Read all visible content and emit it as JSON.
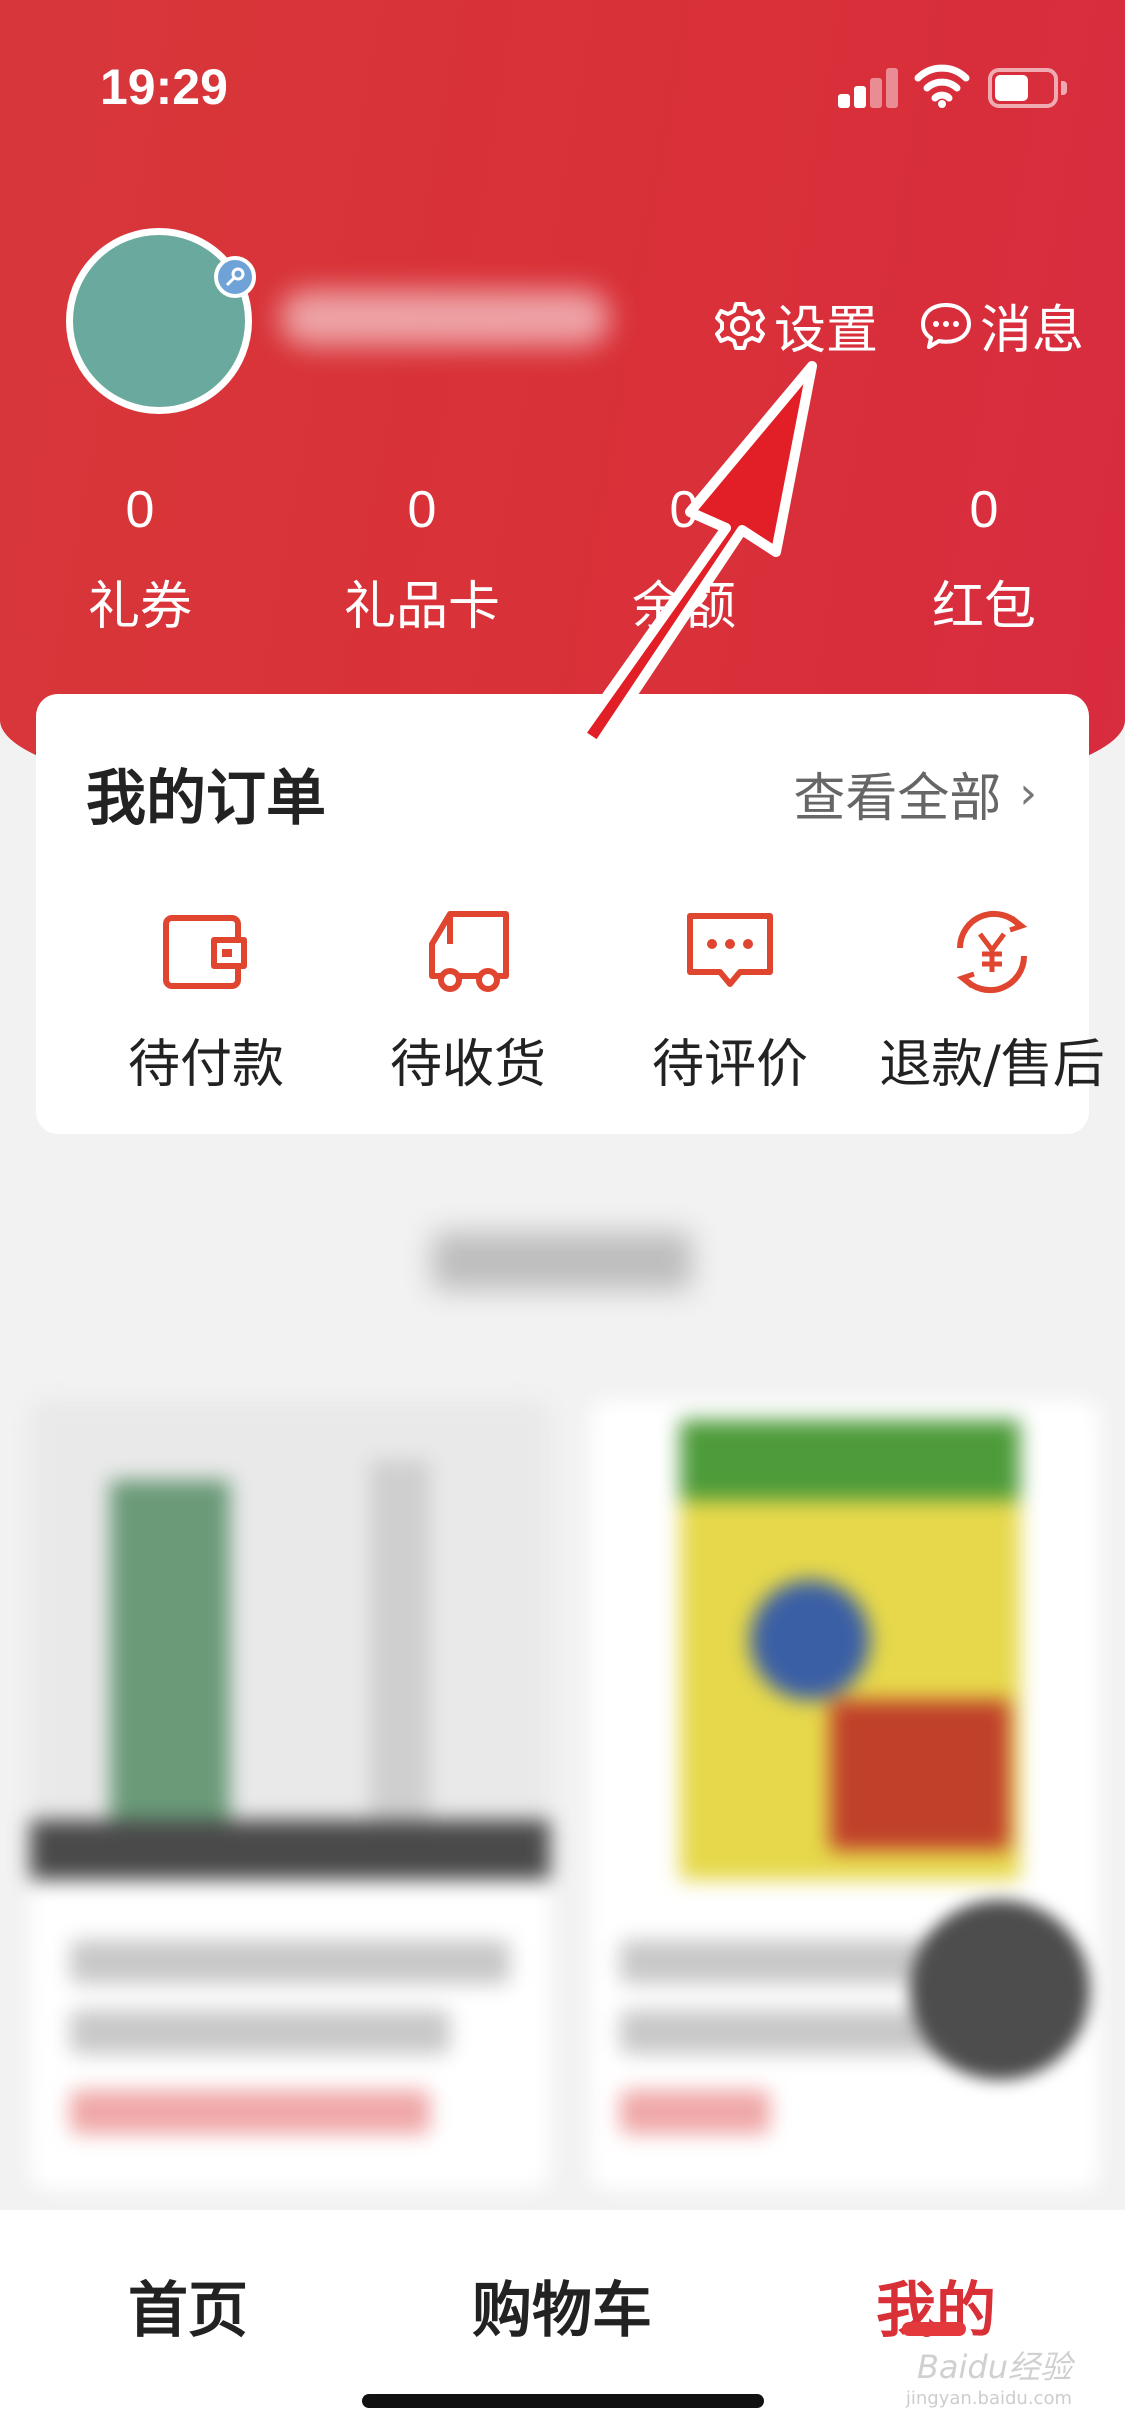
{
  "status_bar": {
    "time": "19:29",
    "battery_level": 0.5,
    "icons": [
      "cellular-signal-icon",
      "wifi-icon",
      "battery-icon"
    ]
  },
  "header": {
    "settings_label": "设置",
    "messages_label": "消息",
    "settings_icon": "gear-icon",
    "messages_icon": "chat-bubble-icon"
  },
  "stats": [
    {
      "value": "0",
      "label": "礼券"
    },
    {
      "value": "0",
      "label": "礼品卡"
    },
    {
      "value": "0",
      "label": "余额"
    },
    {
      "value": "0",
      "label": "红包"
    }
  ],
  "orders": {
    "title": "我的订单",
    "view_all": "查看全部",
    "items": [
      {
        "label": "待付款",
        "icon": "wallet-icon"
      },
      {
        "label": "待收货",
        "icon": "delivery-truck-icon"
      },
      {
        "label": "待评价",
        "icon": "comment-icon"
      },
      {
        "label": "退款/售后",
        "icon": "refund-yen-icon"
      }
    ]
  },
  "tabbar": {
    "tabs": [
      {
        "label": "首页",
        "active": false
      },
      {
        "label": "购物车",
        "active": false
      },
      {
        "label": "我的",
        "active": true
      }
    ]
  },
  "watermark": {
    "brand": "Baidu经验",
    "domain": "jingyan.baidu.com"
  },
  "colors": {
    "header_red": "#d93138",
    "accent_red": "#e4393c",
    "active_tab": "#d93037",
    "avatar_teal": "#6aa99d",
    "page_bg": "#f2f2f2"
  }
}
